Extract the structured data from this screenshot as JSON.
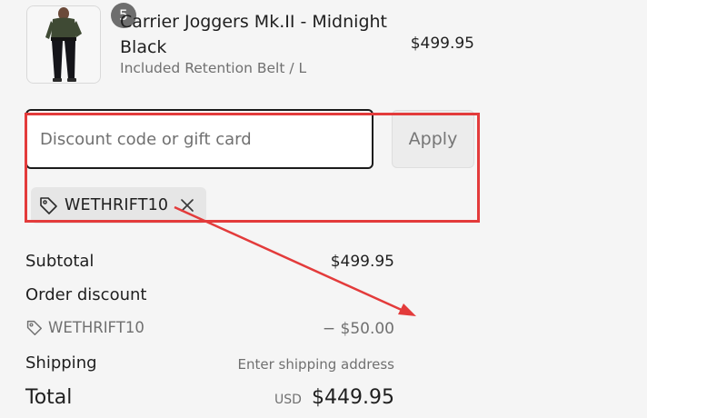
{
  "order": {
    "item": {
      "name": "Carrier Joggers Mk.II - Midnight Black",
      "variant": "Included Retention Belt / L",
      "price": "$499.95",
      "quantity": "5"
    }
  },
  "discount": {
    "placeholder": "Discount code or gift card",
    "value": "",
    "apply_label": "Apply",
    "applied_code": "WETHRIFT10"
  },
  "summary": {
    "subtotal_label": "Subtotal",
    "subtotal_value": "$499.95",
    "order_discount_label": "Order discount",
    "discount_code": "WETHRIFT10",
    "discount_value": "− $50.00",
    "shipping_label": "Shipping",
    "shipping_value": "Enter shipping address",
    "total_label": "Total",
    "total_currency": "USD",
    "total_value": "$449.95"
  },
  "icons": {
    "applied_code": "tag-icon",
    "remove": "close-icon",
    "summary_code": "tag-icon"
  },
  "colors": {
    "annotation": "#e33b3b",
    "panel_background": "#f5f5f5",
    "input_border": "#1b1b1b",
    "muted_text": "#707070"
  }
}
